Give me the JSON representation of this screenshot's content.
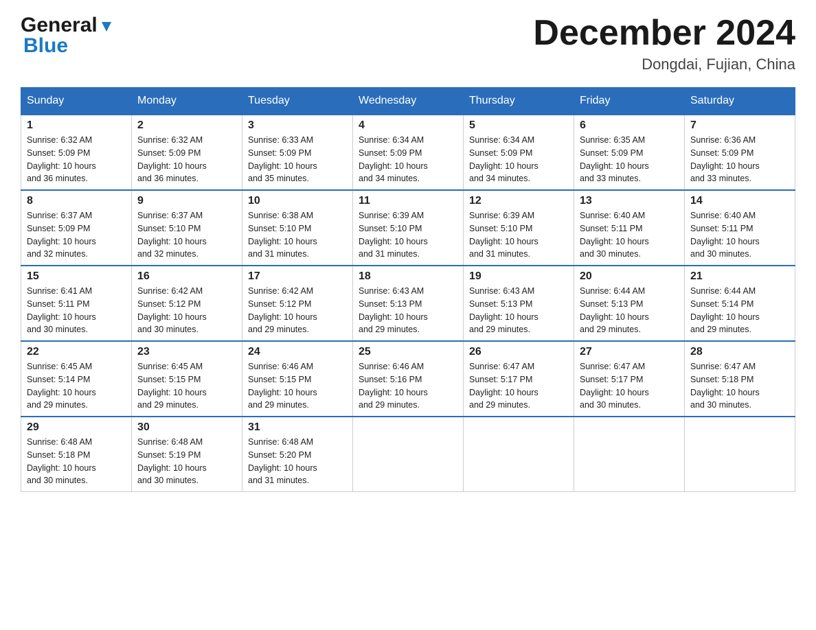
{
  "header": {
    "logo_general": "General",
    "logo_blue": "Blue",
    "month_title": "December 2024",
    "location": "Dongdai, Fujian, China"
  },
  "days_of_week": [
    "Sunday",
    "Monday",
    "Tuesday",
    "Wednesday",
    "Thursday",
    "Friday",
    "Saturday"
  ],
  "weeks": [
    [
      {
        "day": "1",
        "info": "Sunrise: 6:32 AM\nSunset: 5:09 PM\nDaylight: 10 hours\nand 36 minutes."
      },
      {
        "day": "2",
        "info": "Sunrise: 6:32 AM\nSunset: 5:09 PM\nDaylight: 10 hours\nand 36 minutes."
      },
      {
        "day": "3",
        "info": "Sunrise: 6:33 AM\nSunset: 5:09 PM\nDaylight: 10 hours\nand 35 minutes."
      },
      {
        "day": "4",
        "info": "Sunrise: 6:34 AM\nSunset: 5:09 PM\nDaylight: 10 hours\nand 34 minutes."
      },
      {
        "day": "5",
        "info": "Sunrise: 6:34 AM\nSunset: 5:09 PM\nDaylight: 10 hours\nand 34 minutes."
      },
      {
        "day": "6",
        "info": "Sunrise: 6:35 AM\nSunset: 5:09 PM\nDaylight: 10 hours\nand 33 minutes."
      },
      {
        "day": "7",
        "info": "Sunrise: 6:36 AM\nSunset: 5:09 PM\nDaylight: 10 hours\nand 33 minutes."
      }
    ],
    [
      {
        "day": "8",
        "info": "Sunrise: 6:37 AM\nSunset: 5:09 PM\nDaylight: 10 hours\nand 32 minutes."
      },
      {
        "day": "9",
        "info": "Sunrise: 6:37 AM\nSunset: 5:10 PM\nDaylight: 10 hours\nand 32 minutes."
      },
      {
        "day": "10",
        "info": "Sunrise: 6:38 AM\nSunset: 5:10 PM\nDaylight: 10 hours\nand 31 minutes."
      },
      {
        "day": "11",
        "info": "Sunrise: 6:39 AM\nSunset: 5:10 PM\nDaylight: 10 hours\nand 31 minutes."
      },
      {
        "day": "12",
        "info": "Sunrise: 6:39 AM\nSunset: 5:10 PM\nDaylight: 10 hours\nand 31 minutes."
      },
      {
        "day": "13",
        "info": "Sunrise: 6:40 AM\nSunset: 5:11 PM\nDaylight: 10 hours\nand 30 minutes."
      },
      {
        "day": "14",
        "info": "Sunrise: 6:40 AM\nSunset: 5:11 PM\nDaylight: 10 hours\nand 30 minutes."
      }
    ],
    [
      {
        "day": "15",
        "info": "Sunrise: 6:41 AM\nSunset: 5:11 PM\nDaylight: 10 hours\nand 30 minutes."
      },
      {
        "day": "16",
        "info": "Sunrise: 6:42 AM\nSunset: 5:12 PM\nDaylight: 10 hours\nand 30 minutes."
      },
      {
        "day": "17",
        "info": "Sunrise: 6:42 AM\nSunset: 5:12 PM\nDaylight: 10 hours\nand 29 minutes."
      },
      {
        "day": "18",
        "info": "Sunrise: 6:43 AM\nSunset: 5:13 PM\nDaylight: 10 hours\nand 29 minutes."
      },
      {
        "day": "19",
        "info": "Sunrise: 6:43 AM\nSunset: 5:13 PM\nDaylight: 10 hours\nand 29 minutes."
      },
      {
        "day": "20",
        "info": "Sunrise: 6:44 AM\nSunset: 5:13 PM\nDaylight: 10 hours\nand 29 minutes."
      },
      {
        "day": "21",
        "info": "Sunrise: 6:44 AM\nSunset: 5:14 PM\nDaylight: 10 hours\nand 29 minutes."
      }
    ],
    [
      {
        "day": "22",
        "info": "Sunrise: 6:45 AM\nSunset: 5:14 PM\nDaylight: 10 hours\nand 29 minutes."
      },
      {
        "day": "23",
        "info": "Sunrise: 6:45 AM\nSunset: 5:15 PM\nDaylight: 10 hours\nand 29 minutes."
      },
      {
        "day": "24",
        "info": "Sunrise: 6:46 AM\nSunset: 5:15 PM\nDaylight: 10 hours\nand 29 minutes."
      },
      {
        "day": "25",
        "info": "Sunrise: 6:46 AM\nSunset: 5:16 PM\nDaylight: 10 hours\nand 29 minutes."
      },
      {
        "day": "26",
        "info": "Sunrise: 6:47 AM\nSunset: 5:17 PM\nDaylight: 10 hours\nand 29 minutes."
      },
      {
        "day": "27",
        "info": "Sunrise: 6:47 AM\nSunset: 5:17 PM\nDaylight: 10 hours\nand 30 minutes."
      },
      {
        "day": "28",
        "info": "Sunrise: 6:47 AM\nSunset: 5:18 PM\nDaylight: 10 hours\nand 30 minutes."
      }
    ],
    [
      {
        "day": "29",
        "info": "Sunrise: 6:48 AM\nSunset: 5:18 PM\nDaylight: 10 hours\nand 30 minutes."
      },
      {
        "day": "30",
        "info": "Sunrise: 6:48 AM\nSunset: 5:19 PM\nDaylight: 10 hours\nand 30 minutes."
      },
      {
        "day": "31",
        "info": "Sunrise: 6:48 AM\nSunset: 5:20 PM\nDaylight: 10 hours\nand 31 minutes."
      },
      {
        "day": "",
        "info": ""
      },
      {
        "day": "",
        "info": ""
      },
      {
        "day": "",
        "info": ""
      },
      {
        "day": "",
        "info": ""
      }
    ]
  ]
}
